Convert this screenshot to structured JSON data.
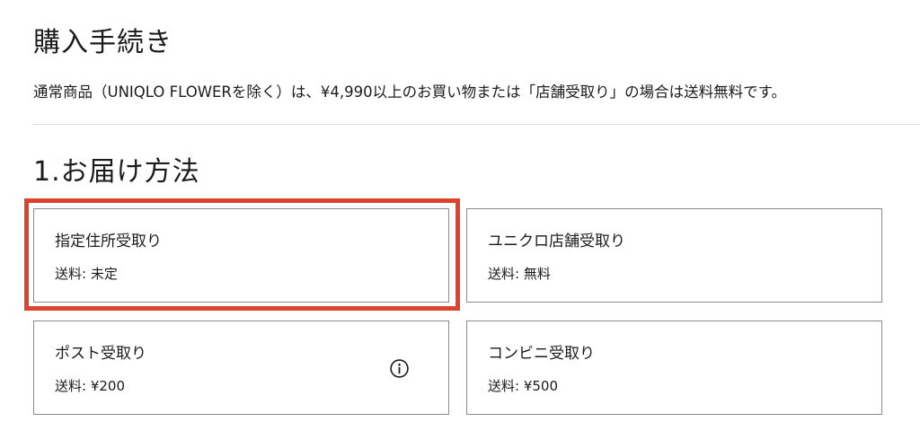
{
  "header": {
    "title": "購入手続き",
    "shipping_note": "通常商品（UNIQLO FLOWERを除く）は、¥4,990以上のお買い物または「店舗受取り」の場合は送料無料です。"
  },
  "delivery": {
    "section_title": "1.お届け方法",
    "selected_option": "指定住所受取り",
    "options": [
      {
        "label": "指定住所受取り",
        "fee": "送料: 未定",
        "selected": true,
        "info_icon": false
      },
      {
        "label": "ユニクロ店舗受取り",
        "fee": "送料: 無料",
        "selected": false,
        "info_icon": false
      },
      {
        "label": "ポスト受取り",
        "fee": "送料: ¥200",
        "selected": false,
        "info_icon": true
      },
      {
        "label": "コンビニ受取り",
        "fee": "送料: ¥500",
        "selected": false,
        "info_icon": false
      }
    ]
  },
  "colors": {
    "selection_highlight": "#e0432d",
    "card_border": "#8a8a8a",
    "divider": "#dddddd",
    "text": "#1b1b1b"
  },
  "icons": {
    "info": "info-circle-icon"
  }
}
